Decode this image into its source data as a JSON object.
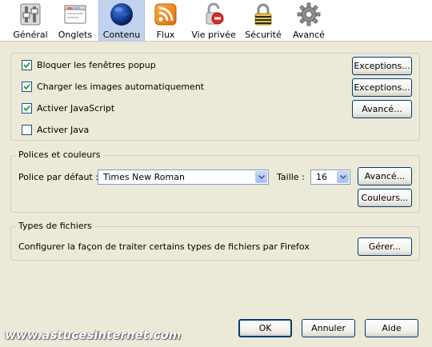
{
  "toolbar": {
    "items": [
      {
        "label": "Général",
        "icon": "toggle-switch-icon"
      },
      {
        "label": "Onglets",
        "icon": "tabs-window-icon"
      },
      {
        "label": "Contenu",
        "icon": "globe-icon",
        "selected": true
      },
      {
        "label": "Flux",
        "icon": "rss-feed-icon"
      },
      {
        "label": "Vie privée",
        "icon": "privacy-icon"
      },
      {
        "label": "Sécurité",
        "icon": "padlock-icon"
      },
      {
        "label": "Avancé",
        "icon": "gear-icon"
      }
    ]
  },
  "content": {
    "popup": {
      "label": "Bloquer les fenêtres popup",
      "checked": true
    },
    "images": {
      "label": "Charger les images automatiquement",
      "checked": true
    },
    "javascript": {
      "label": "Activer JavaScript",
      "checked": true
    },
    "java": {
      "label": "Activer Java",
      "checked": false
    },
    "exceptions_label": "Exceptions...",
    "advanced_label": "Avancé..."
  },
  "fonts": {
    "title": "Polices et couleurs",
    "default_font_label": "Police par défaut :",
    "default_font_value": "Times New Roman",
    "size_label": "Taille :",
    "size_value": "16",
    "advanced_label": "Avancé...",
    "colors_label": "Couleurs..."
  },
  "filetypes": {
    "title": "Types de fichiers",
    "description": "Configurer la façon de traiter certains types de fichiers par Firefox",
    "manage_label": "Gérer..."
  },
  "footer": {
    "ok_label": "OK",
    "cancel_label": "Annuler",
    "help_label": "Aide",
    "watermark": "www.astucesinternet.com"
  },
  "colors": {
    "background": "#ece9d8",
    "selected_tab": "#c1d2ee",
    "button_border": "#003c74"
  }
}
